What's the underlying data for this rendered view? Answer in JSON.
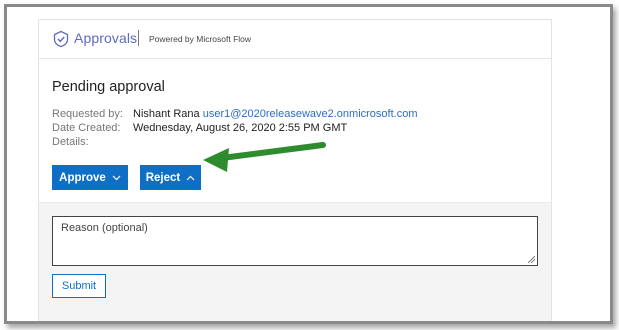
{
  "header": {
    "brand": "Approvals",
    "powered_by": "Powered by Microsoft Flow",
    "logo_icon": "approvals-check-icon"
  },
  "card": {
    "title": "Pending approval",
    "requested_by_label": "Requested by:",
    "requested_by_name": "Nishant Rana",
    "requested_by_email": "user1@2020releasewave2.onmicrosoft.com",
    "date_created_label": "Date Created:",
    "date_created_value": "Wednesday, August 26, 2020 2:55 PM GMT",
    "details_label": "Details:"
  },
  "actions": {
    "approve_label": "Approve",
    "approve_chevron": "⌵",
    "reject_label": "Reject",
    "reject_chevron": "^"
  },
  "panel": {
    "reason_placeholder": "Reason (optional)",
    "submit_label": "Submit"
  },
  "colors": {
    "accent": "#0f6fc6",
    "brand": "#5c6ac4",
    "annotation_arrow": "#2e8b2e"
  }
}
